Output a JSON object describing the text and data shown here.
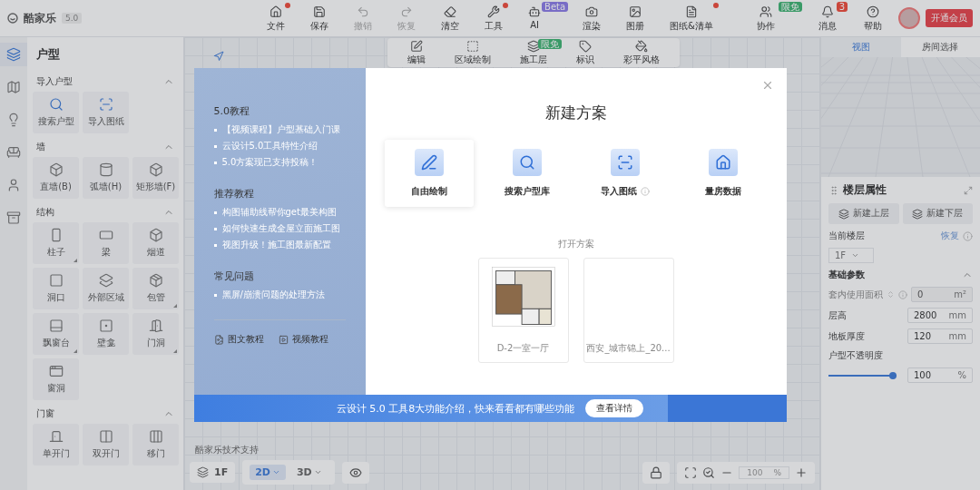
{
  "app": {
    "logo": "酷家乐",
    "version": "5.0"
  },
  "toolbar": [
    {
      "label": "文件",
      "kind": "file",
      "dot": true,
      "disabled": false
    },
    {
      "label": "保存",
      "kind": "save",
      "dot": false,
      "disabled": false
    },
    {
      "label": "撤销",
      "kind": "undo",
      "dot": false,
      "disabled": true
    },
    {
      "label": "恢复",
      "kind": "redo",
      "dot": false,
      "disabled": true
    },
    {
      "label": "清空",
      "kind": "clear",
      "dot": false,
      "disabled": false
    },
    {
      "label": "工具",
      "kind": "tools",
      "dot": true,
      "disabled": false
    },
    {
      "label": "AI",
      "kind": "ai",
      "dot": false,
      "disabled": false,
      "badge": "Beta"
    },
    {
      "label": "渲染",
      "kind": "render",
      "dot": false,
      "disabled": false
    },
    {
      "label": "图册",
      "kind": "album",
      "dot": false,
      "disabled": false
    },
    {
      "label": "图纸&清单",
      "kind": "drawings",
      "dot": true,
      "disabled": false
    }
  ],
  "top_right": [
    {
      "label": "协作",
      "kind": "team",
      "badge": "限免"
    },
    {
      "label": "消息",
      "kind": "bell",
      "count": "3"
    },
    {
      "label": "帮助",
      "kind": "help"
    }
  ],
  "member_button": "开通会员",
  "rail": [
    {
      "kind": "floorplan",
      "selected": true
    },
    {
      "kind": "map",
      "selected": false
    },
    {
      "kind": "light",
      "selected": false
    },
    {
      "kind": "sofa",
      "selected": false
    },
    {
      "kind": "user",
      "selected": false
    },
    {
      "kind": "cabinet",
      "selected": false
    }
  ],
  "left_panel": {
    "title": "户型",
    "sections": [
      {
        "title": "导入户型",
        "expanded": true,
        "items": [
          {
            "label": "搜索户型",
            "kind": "search",
            "more": false
          },
          {
            "label": "导入图纸",
            "kind": "import",
            "more": false
          }
        ]
      },
      {
        "title": "墙",
        "expanded": true,
        "items": [
          {
            "label": "直墙(B)",
            "kind": "box",
            "more": false
          },
          {
            "label": "弧墙(H)",
            "kind": "arc",
            "more": false
          },
          {
            "label": "矩形墙(F)",
            "kind": "box",
            "more": false
          }
        ]
      },
      {
        "title": "结构",
        "expanded": true,
        "items": [
          {
            "label": "柱子",
            "kind": "pillar",
            "more": true
          },
          {
            "label": "梁",
            "kind": "beam",
            "more": false
          },
          {
            "label": "烟道",
            "kind": "box",
            "more": false
          },
          {
            "label": "洞口",
            "kind": "opening",
            "more": false
          },
          {
            "label": "外部区域",
            "kind": "outdoor",
            "more": false
          },
          {
            "label": "包管",
            "kind": "pipe",
            "more": true
          },
          {
            "label": "飘窗台",
            "kind": "bay",
            "more": true
          },
          {
            "label": "壁龛",
            "kind": "niche",
            "more": false
          },
          {
            "label": "门洞",
            "kind": "doorway",
            "more": true
          },
          {
            "label": "窗洞",
            "kind": "windowhole",
            "more": false
          }
        ]
      },
      {
        "title": "门窗",
        "expanded": true,
        "items": [
          {
            "label": "单开门",
            "kind": "door",
            "more": false
          },
          {
            "label": "双开门",
            "kind": "double",
            "more": false
          },
          {
            "label": "移门",
            "kind": "sliding",
            "more": false
          }
        ]
      }
    ]
  },
  "canvas": {
    "tools": [
      {
        "label": "编辑",
        "kind": "edit"
      },
      {
        "label": "区域绘制",
        "kind": "area"
      },
      {
        "label": "施工层",
        "kind": "layers",
        "badge": "限免"
      },
      {
        "label": "标识",
        "kind": "tag"
      },
      {
        "label": "彩平风格",
        "kind": "paint"
      }
    ],
    "credit": "酷家乐技术支持",
    "floor": "1F",
    "views": [
      {
        "label": "2D",
        "selected": true
      },
      {
        "label": "3D",
        "selected": false
      }
    ],
    "zoom": "100",
    "zoom_unit": "%"
  },
  "right_panel": {
    "tabs": [
      {
        "label": "视图",
        "selected": true
      },
      {
        "label": "房间选择",
        "selected": false
      }
    ],
    "title": "楼层属性",
    "floor_buttons": [
      "新建上层",
      "新建下层"
    ],
    "current_floor": "当前楼层",
    "restore": "恢复",
    "floor_value": "1F",
    "section": "基础参数",
    "params": [
      {
        "label": "套内使用面积",
        "value": "0",
        "unit": "m²",
        "disabled": true
      },
      {
        "label": "层高",
        "value": "2800",
        "unit": "mm",
        "disabled": false
      },
      {
        "label": "地板厚度",
        "value": "120",
        "unit": "mm",
        "disabled": false
      }
    ],
    "opacity": {
      "label": "户型不透明度",
      "level": 1,
      "value": "100",
      "unit": "%"
    }
  },
  "modal": {
    "groups": [
      {
        "title": "5.0教程",
        "links": [
          "【视频课程】户型基础入门课",
          "云设计5.0工具特性介绍",
          "5.0方案现已支持投稿！"
        ]
      },
      {
        "title": "推荐教程",
        "links": [
          "构图辅助线帮你get最美构图",
          "如何快速生成全屋立面施工图",
          "视图升级！施工图最新配置"
        ]
      },
      {
        "title": "常见问题",
        "links": [
          "黑屏/崩溃问题的处理方法"
        ]
      }
    ],
    "footer_links": [
      {
        "label": "图文教程",
        "kind": "doc"
      },
      {
        "label": "视频教程",
        "kind": "video"
      }
    ],
    "title": "新建方案",
    "options": [
      {
        "label": "自由绘制",
        "kind": "pen",
        "selected": true,
        "info": false
      },
      {
        "label": "搜索户型库",
        "kind": "search",
        "selected": false,
        "info": false
      },
      {
        "label": "导入图纸",
        "kind": "import",
        "selected": false,
        "info": true
      },
      {
        "label": "量房数据",
        "kind": "house",
        "selected": false,
        "info": false
      }
    ],
    "open_title": "打开方案",
    "recent": [
      {
        "name": "D-2一室一厅",
        "kind": "floorplan"
      },
      {
        "name": "西安_城市锦上_20...",
        "kind": "blank"
      }
    ],
    "banner": {
      "text": "云设计 5.0 工具8大功能介绍，快来看看都有哪些功能",
      "button": "查看详情"
    }
  }
}
